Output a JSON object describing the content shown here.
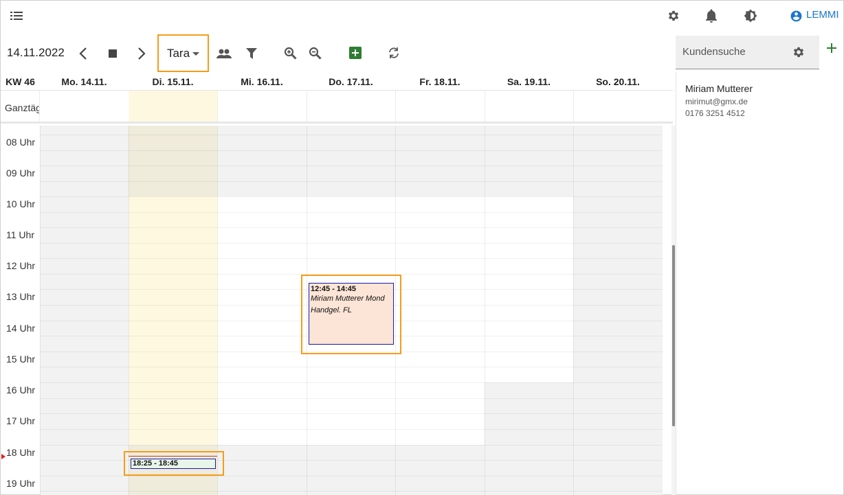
{
  "app": {
    "user_label": "LEMMI"
  },
  "icons": {
    "menu": "list-menu-icon",
    "settings": "gear-icon",
    "notifications": "bell-icon",
    "theme": "brightness-icon",
    "account": "account-circle-icon",
    "prev": "chevron-left-icon",
    "today": "stop-square-icon",
    "next": "chevron-right-icon",
    "people": "people-icon",
    "filter": "filter-icon",
    "zoom_in": "zoom-in-icon",
    "zoom_out": "zoom-out-icon",
    "add": "add-box-icon",
    "refresh": "refresh-icon",
    "plus": "plus-icon"
  },
  "colors": {
    "accent": "#1976d2",
    "highlight": "#f59c1a",
    "add_green": "#2e7d32",
    "today_col": "#fff8e1",
    "event_fill": "#fce4d6",
    "event_border": "#1a1aa6",
    "event2_fill": "#e8f5e9"
  },
  "toolbar": {
    "date": "14.11.2022",
    "view_label": "Tara"
  },
  "calendar": {
    "week_label": "KW 46",
    "days": [
      "Mo. 14.11.",
      "Di. 15.11.",
      "Mi. 16.11.",
      "Do. 17.11.",
      "Fr. 18.11.",
      "Sa. 19.11.",
      "So. 20.11."
    ],
    "allday_label": "Ganztägig",
    "hours": [
      "08 Uhr",
      "09 Uhr",
      "10 Uhr",
      "11 Uhr",
      "12 Uhr",
      "13 Uhr",
      "14 Uhr",
      "15 Uhr",
      "16 Uhr",
      "17 Uhr",
      "18 Uhr",
      "19 Uhr"
    ],
    "events": [
      {
        "time": "12:45 - 14:45",
        "line1": "Miriam Mutterer Mond",
        "line2": "Handgel. FL"
      },
      {
        "time": "18:25 - 18:45"
      }
    ]
  },
  "sidebar": {
    "search_placeholder": "Kundensuche",
    "customer": {
      "name": "Miriam Mutterer",
      "email": "mirimut@gmx.de",
      "phone": "0176 3251 4512"
    }
  }
}
